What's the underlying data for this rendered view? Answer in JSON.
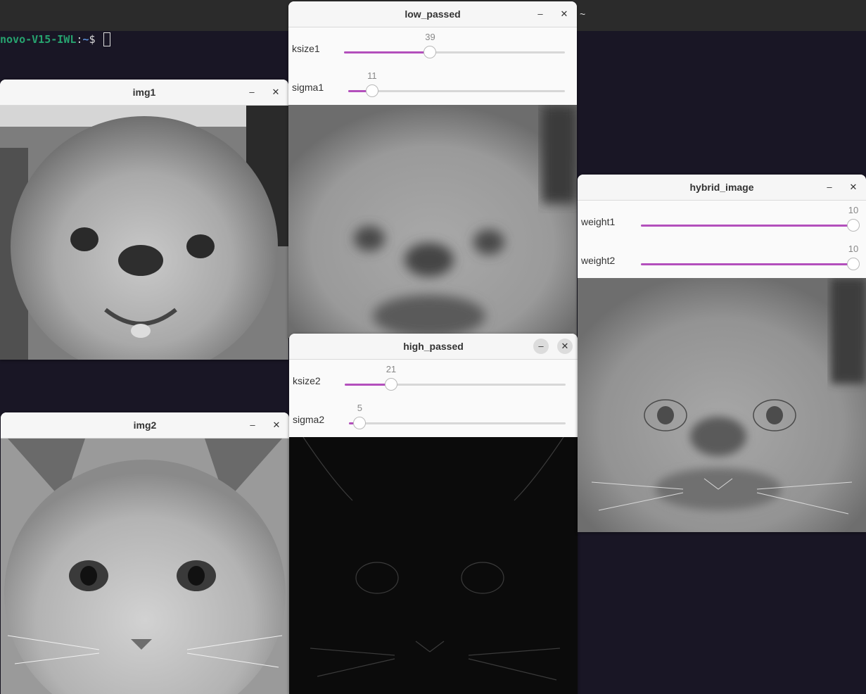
{
  "terminal": {
    "topbar_text": "~",
    "prompt_host": "novo-V15-IWL",
    "prompt_sep": ":",
    "prompt_path": "~",
    "prompt_symbol": "$ "
  },
  "windows": {
    "img1": {
      "title": "img1",
      "min": "–",
      "close": "✕",
      "image_label": "dog grayscale image"
    },
    "img2": {
      "title": "img2",
      "min": "–",
      "close": "✕",
      "image_label": "cat grayscale image"
    },
    "low_passed": {
      "title": "low_passed",
      "min": "–",
      "close": "✕",
      "trackbars": [
        {
          "label": "ksize1",
          "value": "39",
          "fraction": 0.39
        },
        {
          "label": "sigma1",
          "value": "11",
          "fraction": 0.11
        }
      ]
    },
    "high_passed": {
      "title": "high_passed",
      "min": "–",
      "close": "✕",
      "trackbars": [
        {
          "label": "ksize2",
          "value": "21",
          "fraction": 0.21
        },
        {
          "label": "sigma2",
          "value": "5",
          "fraction": 0.05
        }
      ]
    },
    "hybrid_image": {
      "title": "hybrid_image",
      "min": "–",
      "close": "✕",
      "trackbars": [
        {
          "label": "weight1",
          "value": "10",
          "fraction": 1.0
        },
        {
          "label": "weight2",
          "value": "10",
          "fraction": 1.0
        }
      ]
    }
  },
  "colors": {
    "accent": "#b34fbc",
    "desktop": "#191625",
    "terminal_bar": "#2b2b2b"
  }
}
